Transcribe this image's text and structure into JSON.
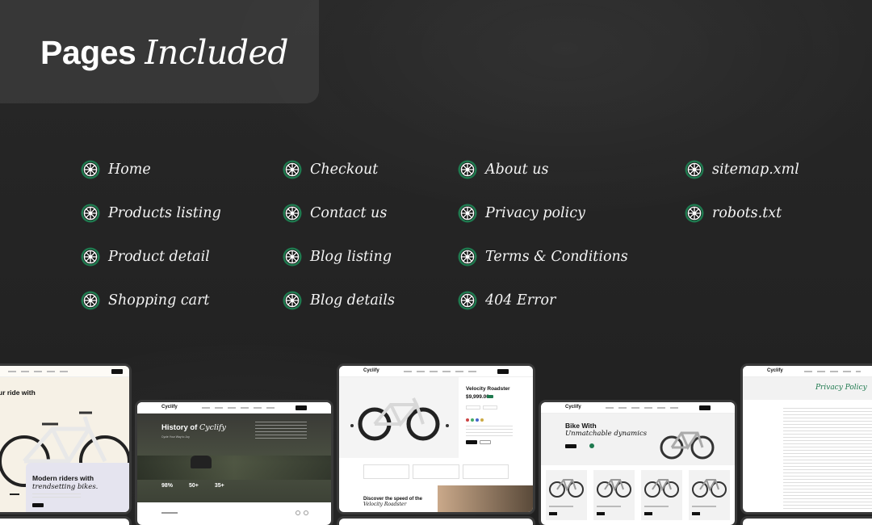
{
  "title": {
    "strong": "Pages",
    "em": "Included"
  },
  "colors": {
    "icon_green": "#1f7a4f",
    "background": "#242424"
  },
  "icon_name": "bicycle-wheel-icon",
  "pages": {
    "col1": [
      "Home",
      "Products listing",
      "Product detail",
      "Shopping cart"
    ],
    "col2": [
      "Checkout",
      "Contact us",
      "Blog listing",
      "Blog details"
    ],
    "col3": [
      "About us",
      "Privacy policy",
      "Terms & Conditions",
      "404 Error"
    ],
    "col4": [
      "sitemap.xml",
      "robots.txt"
    ]
  },
  "previews": {
    "home": {
      "hero_prefix": "ur ride with",
      "banner_line1": "Modern riders with",
      "banner_line2": "trendsetting bikes."
    },
    "about": {
      "logo": "Cyclify",
      "heading": "History of",
      "heading_em": "Cyclify",
      "sub": "Cycle Your Way to Joy",
      "stats": [
        "98%",
        "50+",
        "35+"
      ]
    },
    "product": {
      "logo": "Cyclify",
      "name": "Velocity Roadster",
      "price": "$9,999.00",
      "bottom_heading": "Discover the speed of the",
      "bottom_heading_em": "Velocity Roadster"
    },
    "listing": {
      "logo": "Cyclify",
      "heading": "Bike With",
      "heading_em": "Unmatchable dynamics"
    },
    "privacy": {
      "logo": "Cyclify",
      "heading": "Privacy Policy"
    }
  }
}
